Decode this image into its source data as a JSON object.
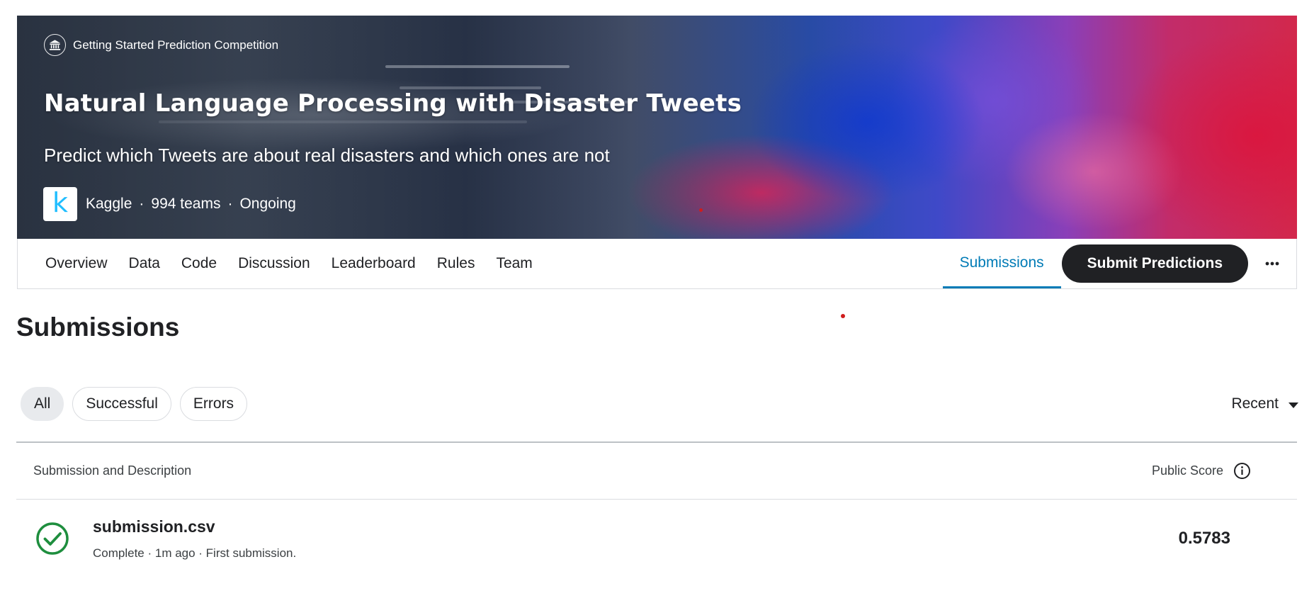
{
  "hero": {
    "eyebrow": "Getting Started Prediction Competition",
    "title": "Natural Language Processing with Disaster Tweets",
    "subtitle": "Predict which Tweets are about real disasters and which ones are not",
    "org_logo_letter": "k",
    "org_name": "Kaggle",
    "teams": "994 teams",
    "status": "Ongoing",
    "separator": "·"
  },
  "nav": {
    "tabs": [
      "Overview",
      "Data",
      "Code",
      "Discussion",
      "Leaderboard",
      "Rules",
      "Team"
    ],
    "active_tab": "Submissions",
    "submit_label": "Submit Predictions",
    "more_icon": "more-horizontal-icon"
  },
  "page": {
    "title": "Submissions"
  },
  "filters": {
    "chips": [
      "All",
      "Successful",
      "Errors"
    ],
    "selected": "All",
    "sort_label": "Recent"
  },
  "table": {
    "header_description": "Submission and Description",
    "header_score": "Public Score",
    "rows": [
      {
        "file_name": "submission.csv",
        "meta": "Complete · 1m ago · First submission.",
        "score": "0.5783",
        "status_icon": "check-circle-icon"
      }
    ]
  },
  "colors": {
    "accent": "#007bb6",
    "primary_button": "#202124",
    "success": "#1e8e3e",
    "kaggle_blue": "#20beff"
  }
}
